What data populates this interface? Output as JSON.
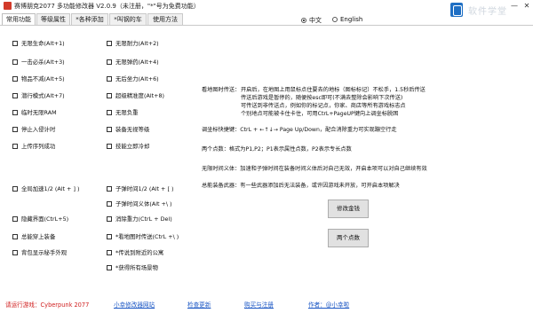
{
  "window": {
    "title": "赛博朋克2077 多功能修改器 V2.0.9（未注册，\"*\"号为免费功能）",
    "watermark": "软件学堂"
  },
  "tabs": [
    "常用功能",
    "等级属性",
    "*各种添加",
    "*叫钢的车",
    "使用方法"
  ],
  "language": {
    "options": [
      "中文",
      "English"
    ],
    "selected": "中文"
  },
  "checkboxes": {
    "col1": [
      "无限生命(Alt+1)",
      "一击必杀(Alt+3)",
      "物品不减(Alt+5)",
      "潜行模式(Alt+7)",
      "临时无限RAM",
      "停止入侵计时",
      "上传序列成功"
    ],
    "col2": [
      "无限耐力(Alt+2)",
      "无限弹药(Alt+4)",
      "无后坐力(Alt+6)",
      "超级精准度(Alt+8)",
      "无限负重",
      "装备无视等级",
      "技能立即冷却"
    ],
    "col1_lower": [
      "全局加速1/2 (Alt + ] )",
      "隐藏界面(CtrL+5)",
      "总能穿上装备",
      "背包显示秘手外观"
    ],
    "col2_lower": [
      "子弹时间1/2 (Alt + [ )",
      "子弹时间义体(Alt +\\ )",
      "消除重力(CtrL + Del)",
      "*看地图时传送(CtrL +\\ )",
      "*传说到附近的公寓",
      "*获得所有场景物"
    ]
  },
  "info": {
    "teleport_title": "看地图时传送：",
    "teleport_lines": [
      "开启后，在地图上用鼠标点住要去的地标（图标标记）不松手，1.5秒后传送",
      "传送后游戏是暂停的，随便按esc即可(不满去整除会影响下次传送)",
      "可传送到非传送点，例如你的标记点，你家、商店等所有游戏标志点",
      "个别地点可能被卡住卡住，可用CtrL+PageUP键向上调坐标脱困"
    ],
    "coord_hotkey": "调坐标快捷键：CtrL + ←↑↓→ Page Up/Down，配合消除重力可实现蹦空行走",
    "two_points": "两个点数：格式为P1,P2；P1表示属性点数，P2表示专长点数",
    "unlimited_implant": "无限时间义体：加速和子弹时间在装备时间义体后对自己无效，开启本项可以对自己继续有效",
    "always_equip": "总能装备武器：有一些武器添加后无法装备，或许因游戏未开放，可开启本项解决"
  },
  "buttons": {
    "modify_money": "修改金钱",
    "two_points": "两个点数"
  },
  "footer": {
    "game_label": "请运行游戏：Cyberpunk 2077",
    "links": [
      "小幸修改器网站",
      "检查更新",
      "购买与注册"
    ],
    "author": "作者：@小幸啦"
  },
  "colors": {
    "accent_red": "#d02020",
    "link_blue": "#1a56c4"
  }
}
